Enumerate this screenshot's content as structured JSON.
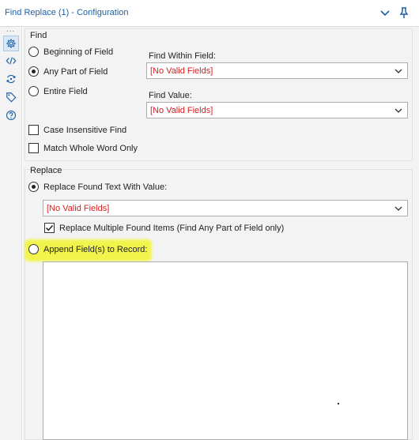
{
  "titlebar": {
    "title": "Find Replace (1) - Configuration",
    "icons": [
      "chevron-down-icon",
      "pin-icon"
    ]
  },
  "sidebar": {
    "more": "...",
    "icons": [
      "gear-icon",
      "code-icon",
      "connection-icon",
      "tag-icon",
      "help-icon"
    ]
  },
  "find": {
    "title": "Find",
    "options": [
      {
        "label": "Beginning of Field",
        "checked": false
      },
      {
        "label": "Any Part of Field",
        "checked": true
      },
      {
        "label": "Entire Field",
        "checked": false
      }
    ],
    "within_label": "Find Within Field:",
    "within_value": "[No Valid Fields]",
    "value_label": "Find Value:",
    "value_value": "[No Valid Fields]",
    "case_insensitive": "Case Insensitive Find",
    "whole_word": "Match Whole Word Only"
  },
  "replace": {
    "title": "Replace",
    "found_text_label": "Replace Found Text With Value:",
    "found_text_value": "[No Valid Fields]",
    "multiple_label": "Replace Multiple Found Items (Find Any Part of Field only)",
    "multiple_checked": true,
    "append_label": "Append Field(s) to Record:"
  },
  "colors": {
    "title_blue": "#1d5fa8",
    "invalid_red": "#d81e1e",
    "highlight_yellow": "#f2f53b",
    "panel_gray": "#f3f3f3"
  }
}
